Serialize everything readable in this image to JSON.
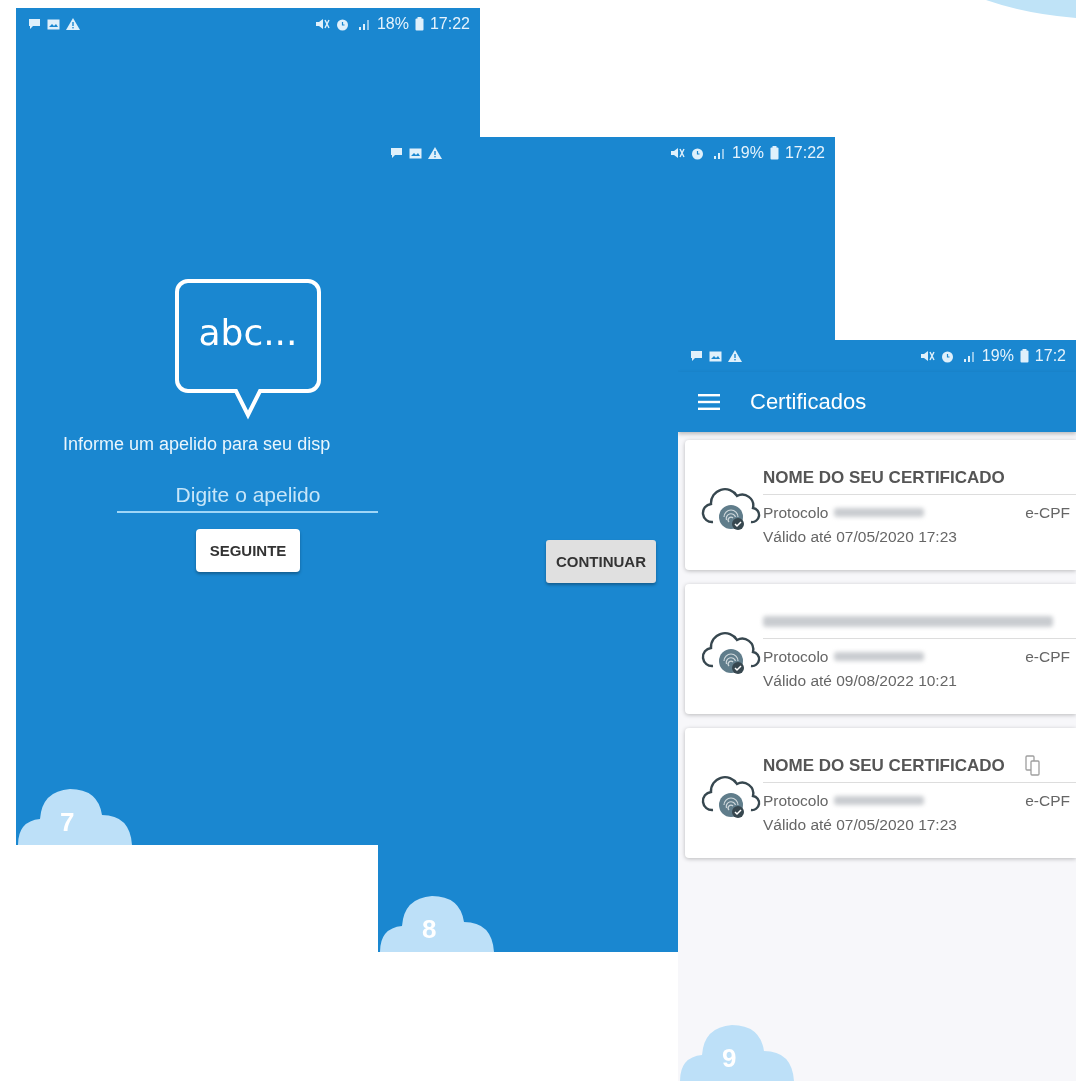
{
  "screens": [
    {
      "kind": "nickname",
      "number": "7",
      "status_bar": {
        "battery": "18%",
        "time": "17:22"
      },
      "bubble_text": "abc...",
      "prompt": "Informe um apelido para seu disp",
      "field": {
        "placeholder": "Digite o apelido"
      },
      "button": "SEGUINTE"
    },
    {
      "kind": "continue",
      "number": "8",
      "status_bar": {
        "battery": "19%",
        "time": "17:22"
      },
      "button": "CONTINUAR"
    },
    {
      "kind": "list",
      "number": "9",
      "status_bar": {
        "battery": "19%",
        "time": "17:2"
      },
      "title": "Certificados",
      "certificates": [
        {
          "name": "NOME DO SEU CERTIFICADO",
          "protocol_label": "Protocolo",
          "type": "e-CPF",
          "valid": "Válido até 07/05/2020 17:23",
          "device_icon": false
        },
        {
          "protocol_label": "Protocolo",
          "type": "e-CPF",
          "valid": "Válido até 09/08/2022 10:21",
          "device_icon": false
        },
        {
          "name": "NOME DO SEU CERTIFICADO",
          "protocol_label": "Protocolo",
          "type": "e-CPF",
          "valid": "Válido até 07/05/2020 17:23",
          "device_icon": true
        }
      ]
    }
  ]
}
